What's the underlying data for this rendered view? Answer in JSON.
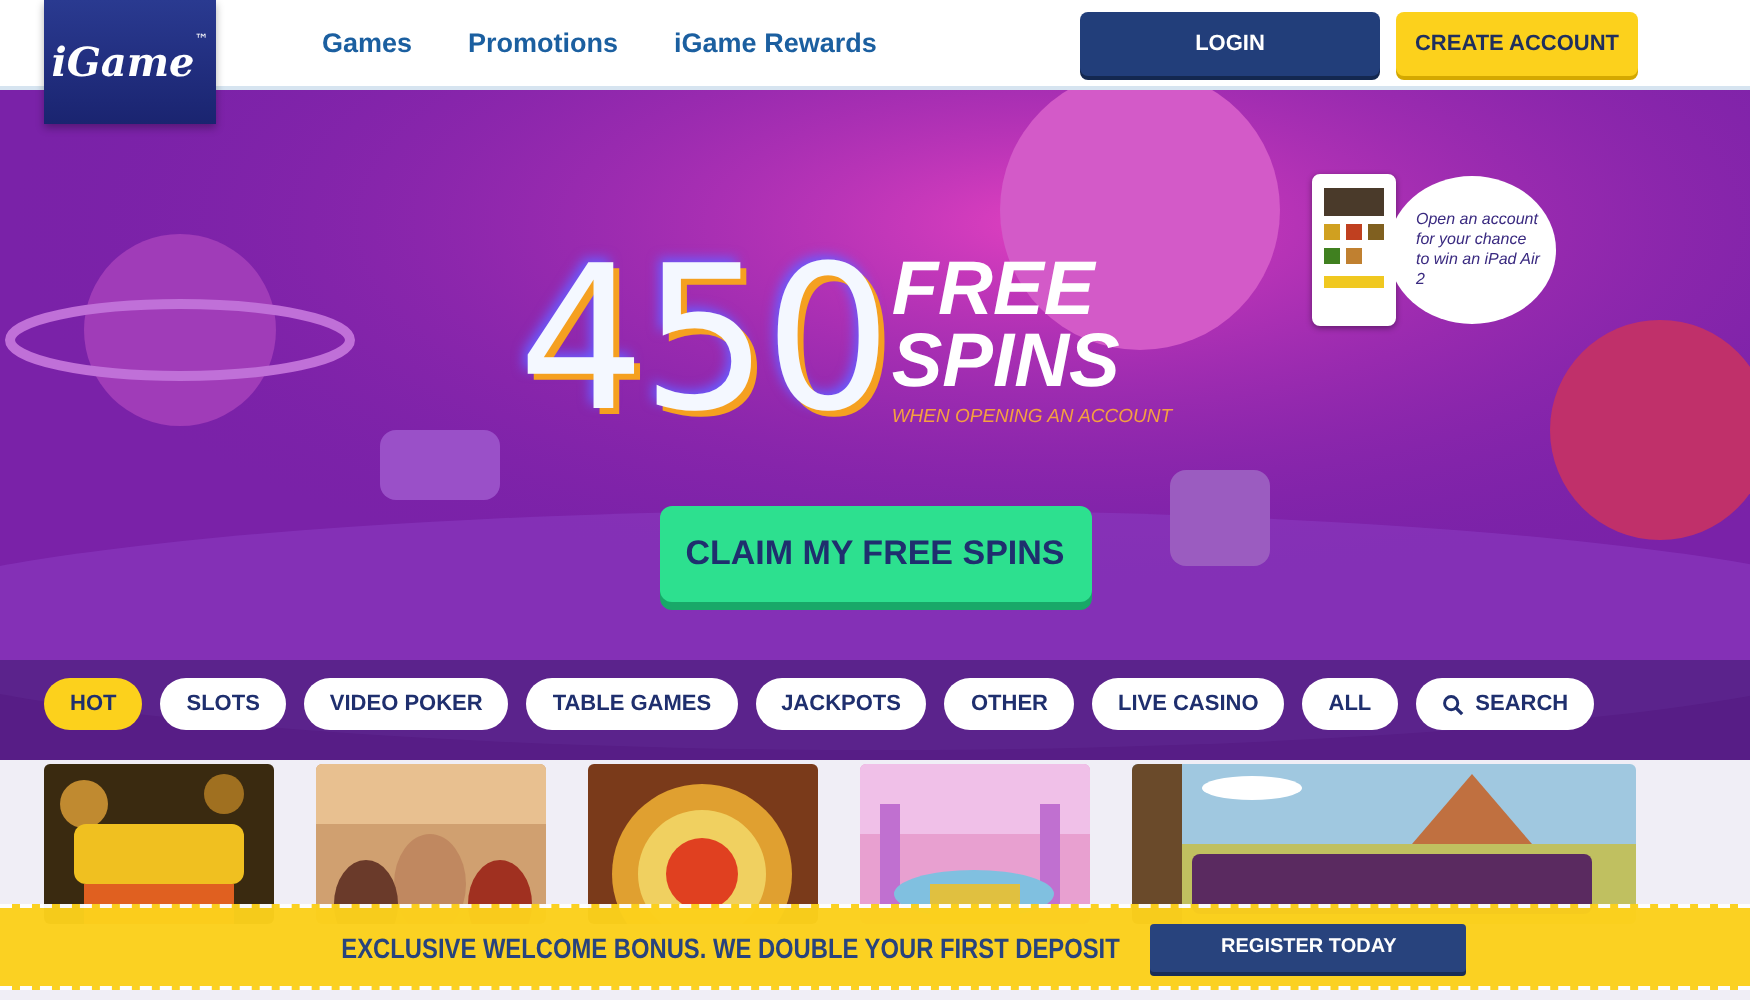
{
  "header": {
    "logo": "iGame",
    "logo_mark": "™",
    "nav": [
      "Games",
      "Promotions",
      "iGame Rewards"
    ],
    "buttons": [
      {
        "label": "LOGIN",
        "kind": "primary"
      },
      {
        "label": "CREATE ACCOUNT",
        "kind": "accent"
      }
    ]
  },
  "hero": {
    "number": "450",
    "headline": [
      "FREE",
      "SPINS"
    ],
    "subtitle": "WHEN OPENING AN ACCOUNT",
    "cta": "CLAIM MY FREE SPINS",
    "promo": "Open an account for your chance to win an iPad Air 2"
  },
  "filters": [
    {
      "label": "HOT",
      "selected": true
    },
    {
      "label": "SLOTS",
      "selected": false
    },
    {
      "label": "VIDEO POKER",
      "selected": false
    },
    {
      "label": "TABLE GAMES",
      "selected": false
    },
    {
      "label": "JACKPOTS",
      "selected": false
    },
    {
      "label": "OTHER",
      "selected": false
    },
    {
      "label": "LIVE CASINO",
      "selected": false
    },
    {
      "label": "ALL",
      "selected": false
    },
    {
      "label": "SEARCH",
      "selected": false,
      "kind": "search"
    }
  ],
  "games": [
    {
      "kind": "picture",
      "wide": false
    },
    {
      "kind": "picture",
      "wide": false
    },
    {
      "kind": "picture",
      "wide": false
    },
    {
      "kind": "picture",
      "wide": false
    },
    {
      "kind": "picture",
      "wide": true
    }
  ],
  "banner": {
    "text": "EXCLUSIVE WELCOME BONUS. WE DOUBLE YOUR FIRST DEPOSIT",
    "button": "REGISTER TODAY"
  }
}
